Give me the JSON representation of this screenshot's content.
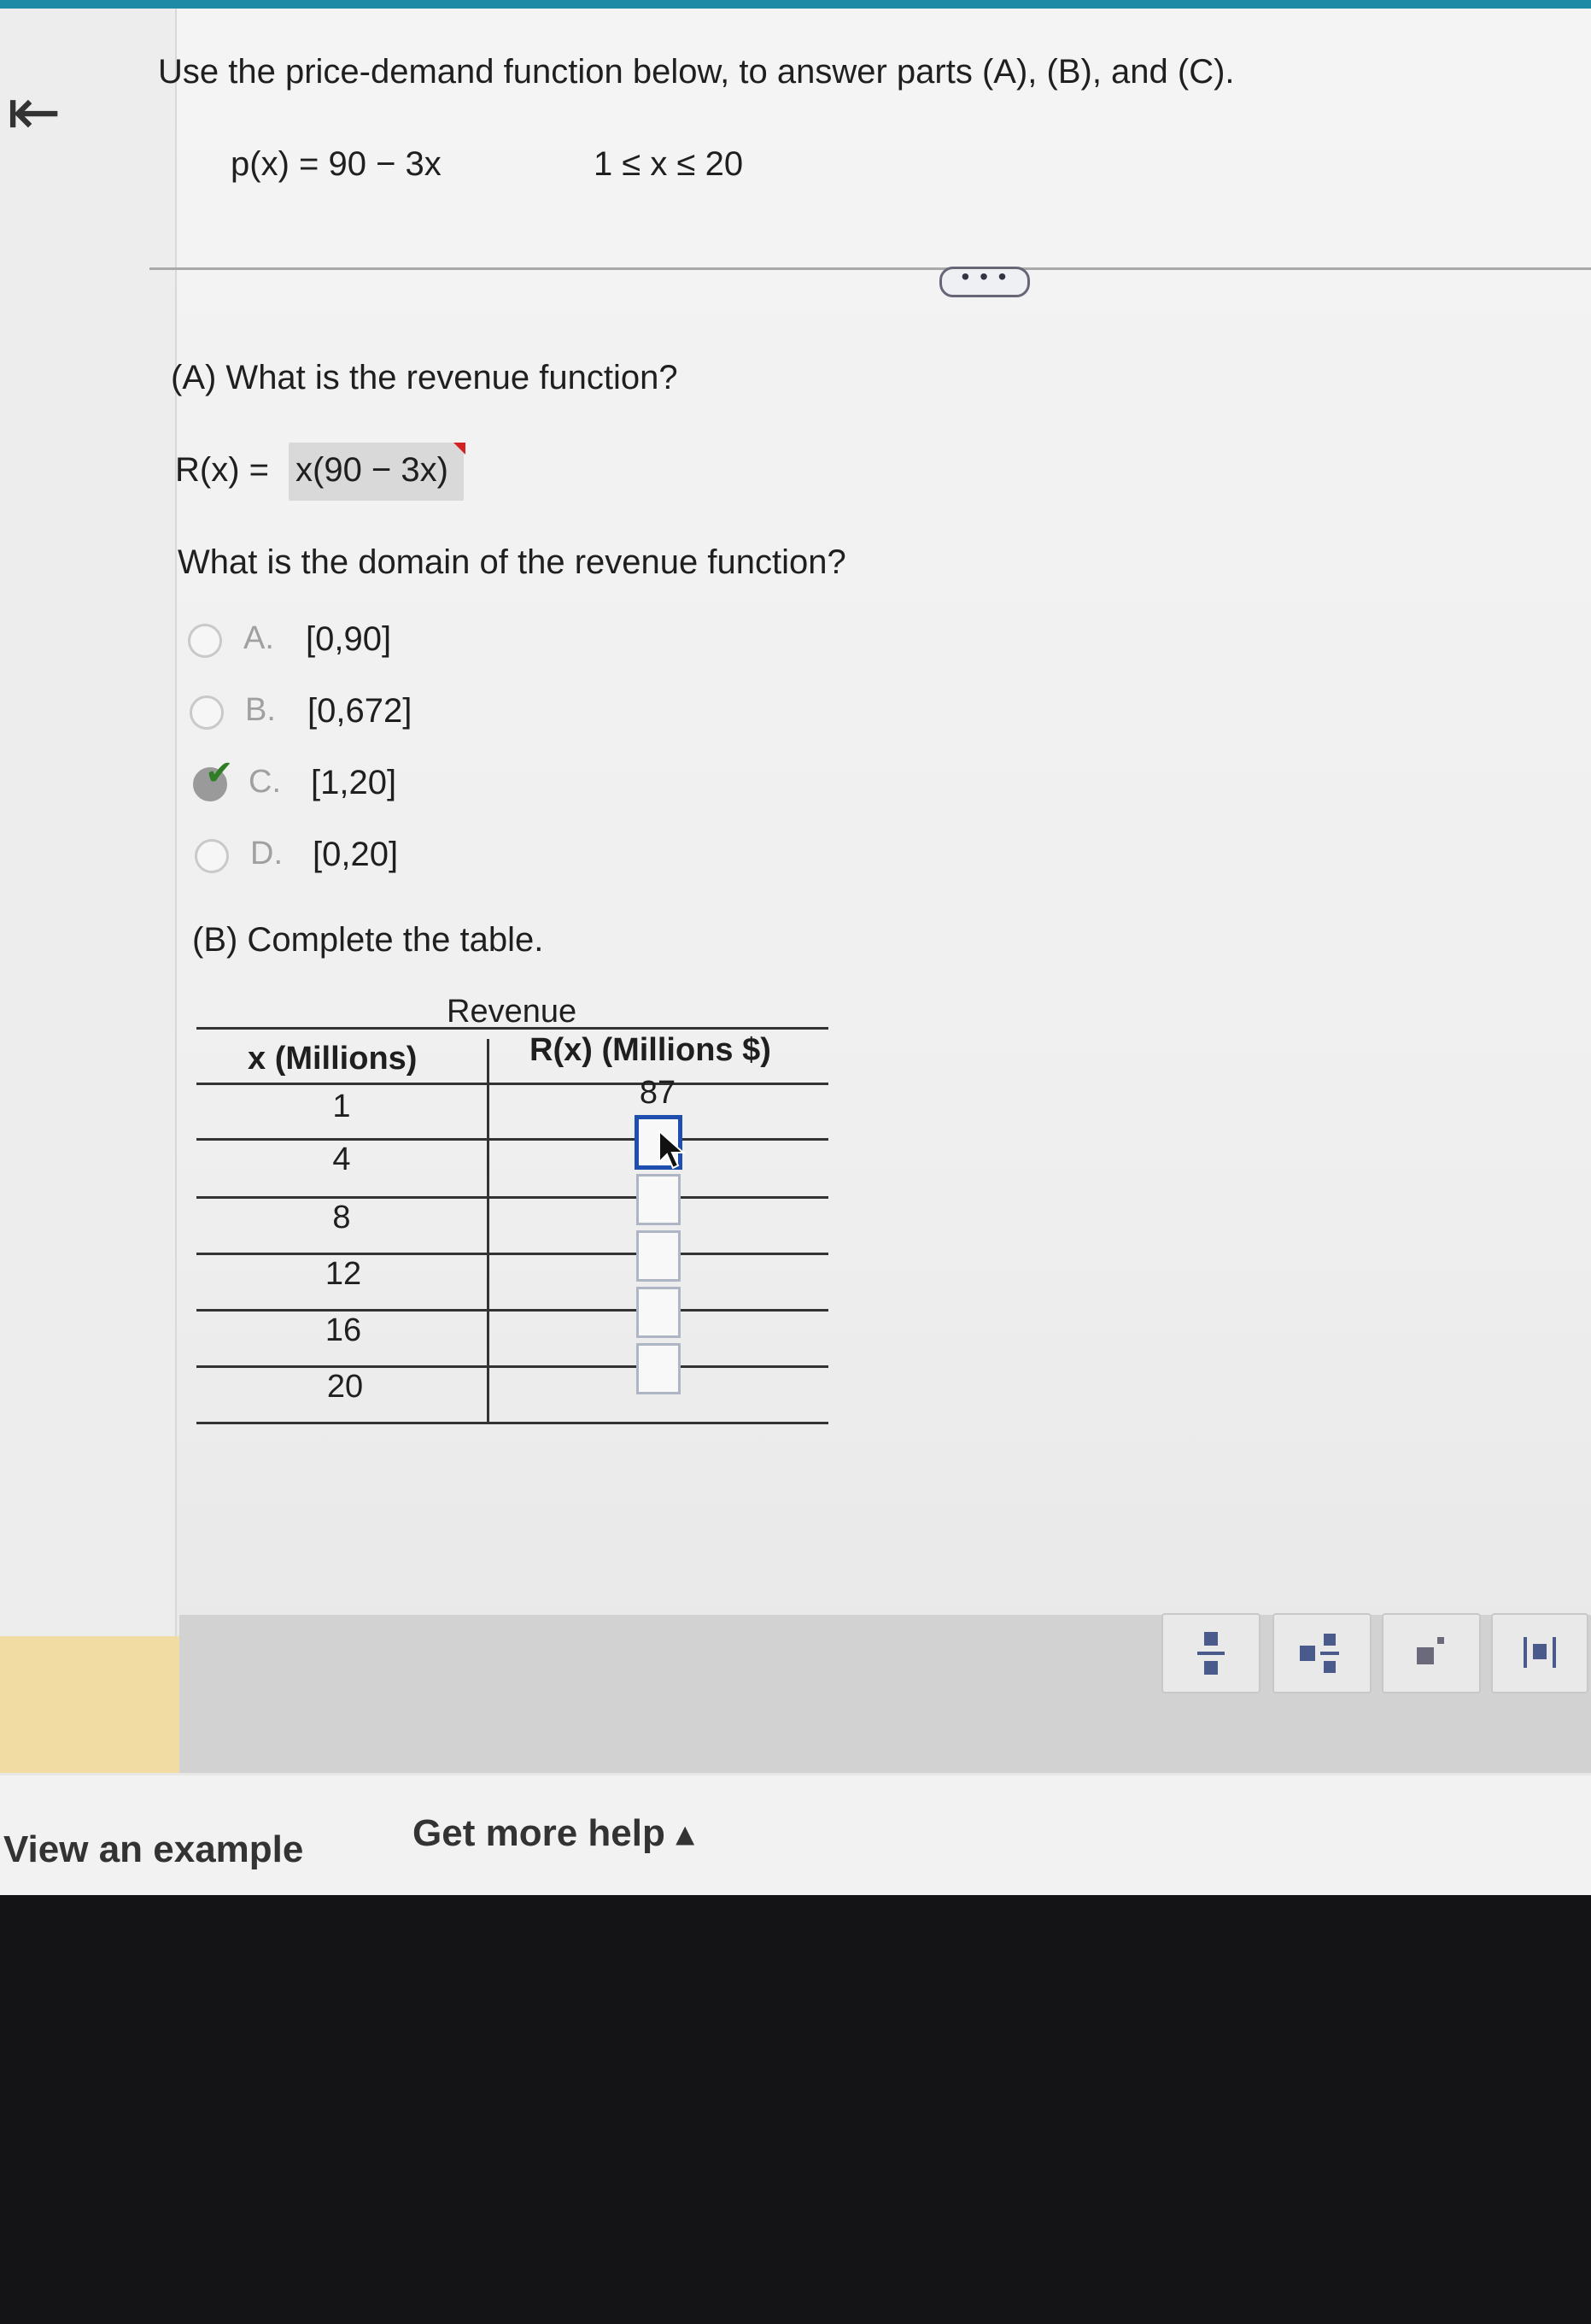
{
  "question": {
    "intro": "Use the price-demand function below, to answer parts (A), (B), and (C).",
    "price_function": "p(x) = 90 − 3x",
    "constraint": "1 ≤ x ≤ 20",
    "more_label": "• • •"
  },
  "part_a": {
    "question": "(A) What is the revenue function?",
    "answer_label": "R(x) =",
    "answer_value": "x(90 − 3x)",
    "domain_question": "What is the domain of the revenue function?",
    "options": [
      {
        "letter": "A.",
        "text": "[0,90]",
        "selected": false
      },
      {
        "letter": "B.",
        "text": "[0,672]",
        "selected": false
      },
      {
        "letter": "C.",
        "text": "[1,20]",
        "selected": true
      },
      {
        "letter": "D.",
        "text": "[0,20]",
        "selected": false
      }
    ]
  },
  "part_b": {
    "question": "(B) Complete the table.",
    "caption": "Revenue",
    "headers": [
      "x (Millions)",
      "R(x) (Millions $)"
    ],
    "rows": [
      {
        "x": "1",
        "r": "87"
      },
      {
        "x": "4",
        "r": ""
      },
      {
        "x": "8",
        "r": ""
      },
      {
        "x": "12",
        "r": ""
      },
      {
        "x": "16",
        "r": ""
      },
      {
        "x": "20",
        "r": ""
      }
    ]
  },
  "toolbar": {
    "tools": [
      "fraction-tool",
      "mixed-number-tool",
      "exponent-tool",
      "absolute-value-tool"
    ]
  },
  "links": {
    "view_example": "View an example",
    "get_more_help": "Get more help ▴"
  }
}
